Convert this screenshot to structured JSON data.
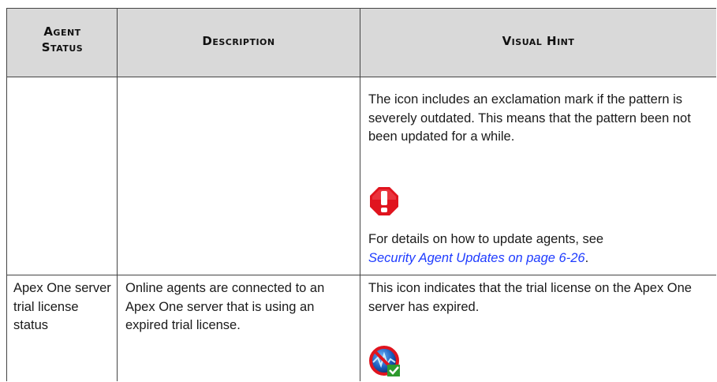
{
  "table": {
    "headers": [
      "Agent Status",
      "Description",
      "Visual Hint"
    ],
    "row1": {
      "status": "",
      "description": "",
      "hint_text_1": "The icon includes an exclamation mark if the pattern is severely outdated. This means that the pattern been not been updated for a while.",
      "hint_text_2": "For details on how to update agents, see",
      "hint_link": "Security Agent Updates on page 6-26",
      "hint_after_link": ".",
      "icon": "red-exclamation-warning-icon",
      "icon_color": "#e0141e"
    },
    "row2": {
      "status": "Apex One server trial license status",
      "description": "Online agents are connected to an Apex One server that is using an expired trial license.",
      "hint_text": "This icon indicates that the trial license on the Apex One server has expired.",
      "icon": "expired-trial-license-icon"
    }
  },
  "colors": {
    "header_bg": "#d9d9d9",
    "link": "#1f3cff",
    "border": "#444444"
  }
}
